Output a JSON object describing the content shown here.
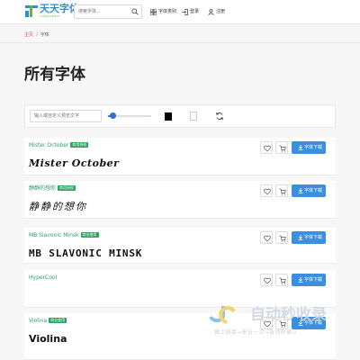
{
  "header": {
    "logo_text": "天天字体",
    "logo_sub": "TIANTIANZITI",
    "search_placeholder": "搜索字体...",
    "nav": [
      {
        "label": "字体类别",
        "icon": "grid-icon"
      },
      {
        "label": "登录",
        "icon": "login-icon"
      },
      {
        "label": "注册",
        "icon": "user-icon"
      }
    ]
  },
  "breadcrumb": {
    "home": "主页",
    "separator": "/",
    "current": "字体"
  },
  "page_title": "所有字体",
  "toolbar": {
    "preview_placeholder": "输入或自定义预览文字",
    "size_slider_fraction": 0.1,
    "text_color": "#000000",
    "bg_color": "#ffffff"
  },
  "fonts": [
    {
      "name": "Mister October",
      "badge": "商用授权",
      "sample": "Mister October",
      "download": "字体下载"
    },
    {
      "name": "静静的想你",
      "badge": "商用授权",
      "sample": "静静的想你",
      "download": "字体下载"
    },
    {
      "name": "MB Slavonic Minsk",
      "badge": "商业使用",
      "sample": "MB SLAVONIC MINSK",
      "download": "字体下载"
    },
    {
      "name": "HyperCool",
      "badge": "商业使用",
      "sample": "",
      "download": "字体下载"
    },
    {
      "name": "Violina",
      "badge": "商业使用",
      "sample": "Violina",
      "download": "字体下载"
    }
  ],
  "watermark": {
    "title": "自动秒收录",
    "sub": "做上链接→来访一次→自动收录→"
  },
  "colors": {
    "accent": "#3b8fe0",
    "green": "#2f9d68",
    "badge": "#2ba35e",
    "crumb_home": "#e74c3c"
  }
}
